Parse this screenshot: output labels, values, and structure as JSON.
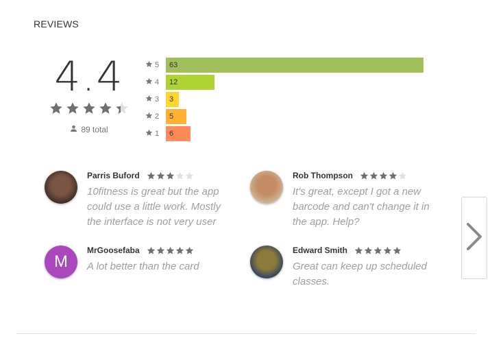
{
  "section": {
    "title": "REVIEWS"
  },
  "summary": {
    "average_rating": "4.4",
    "average_value": 4.4,
    "max_rating": 5,
    "total_label": "89 total",
    "total_icon": "person-icon"
  },
  "histogram": [
    {
      "stars": "5",
      "count": "63",
      "fraction": 1.0,
      "color": "#9fc05a"
    },
    {
      "stars": "4",
      "count": "12",
      "fraction": 0.19,
      "color": "#b0d334"
    },
    {
      "stars": "3",
      "count": "3",
      "fraction": 0.05,
      "color": "#ffd533"
    },
    {
      "stars": "2",
      "count": "5",
      "fraction": 0.08,
      "color": "#ffb233"
    },
    {
      "stars": "1",
      "count": "6",
      "fraction": 0.095,
      "color": "#ff8b5a"
    }
  ],
  "reviews": [
    {
      "name": "Parris Buford",
      "rating": 3,
      "text": "10fitness is great but the app could use a little work. Mostly the interface is not very user",
      "avatar": "photo",
      "avatar_colors": [
        "#3b2b24",
        "#7a5543"
      ]
    },
    {
      "name": "Rob Thompson",
      "rating": 4,
      "text": "It's great, except I got a new barcode and can't change it in the app. Help?",
      "avatar": "photo",
      "avatar_colors": [
        "#cdbb98",
        "#c58a66"
      ]
    },
    {
      "name": "MrGoosefaba",
      "rating": 5,
      "text": "A lot better than the card",
      "avatar": "letter",
      "avatar_letter": "M",
      "avatar_colors": [
        "#ab47bc",
        "#ab47bc"
      ]
    },
    {
      "name": "Edward Smith",
      "rating": 5,
      "text": "Great can keep up scheduled classes.",
      "avatar": "photo",
      "avatar_colors": [
        "#2c3e66",
        "#8c7a3a"
      ]
    }
  ],
  "navigation": {
    "next_icon": "chevron-right-icon"
  },
  "colors": {
    "star_filled": "#6f6f6f",
    "star_empty": "#e0e0e0"
  }
}
